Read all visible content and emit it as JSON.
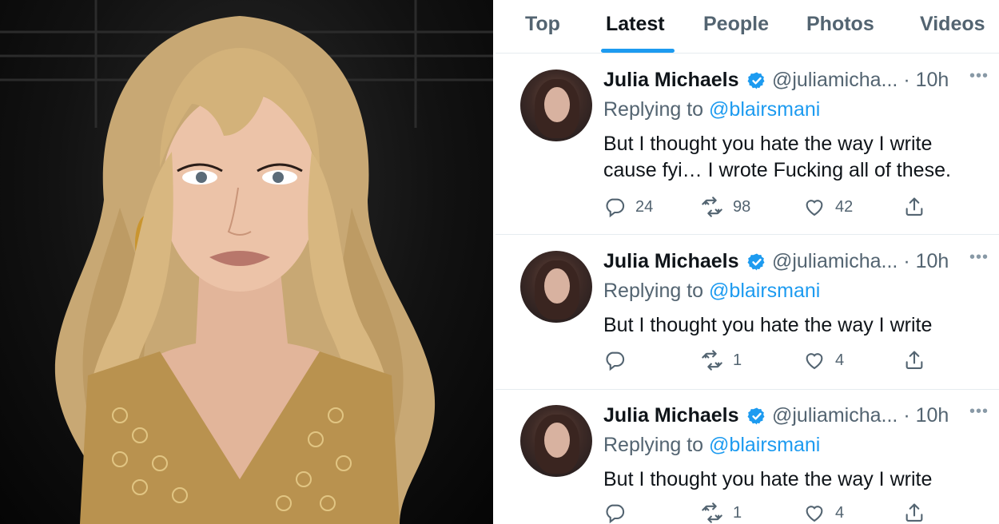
{
  "tabs": [
    {
      "label": "Top"
    },
    {
      "label": "Latest"
    },
    {
      "label": "People"
    },
    {
      "label": "Photos"
    },
    {
      "label": "Videos"
    }
  ],
  "active_tab": "Latest",
  "accent_color": "#1d9bf0",
  "tweets": [
    {
      "name": "Julia Michaels",
      "handle": "@juliamicha... · 10h",
      "replying_prefix": "Replying to ",
      "replying_to": "@blairsmani",
      "text": "But I thought you hate the way I write cause fyi… I wrote Fucking all of these.",
      "replies": "24",
      "retweets": "98",
      "likes": "42"
    },
    {
      "name": "Julia Michaels",
      "handle": "@juliamicha... · 10h",
      "replying_prefix": "Replying to ",
      "replying_to": "@blairsmani",
      "text": "But I thought you hate the way I write",
      "replies": "",
      "retweets": "1",
      "likes": "4"
    },
    {
      "name": "Julia Michaels",
      "handle": "@juliamicha... · 10h",
      "replying_prefix": "Replying to ",
      "replying_to": "@blairsmani",
      "text": "But I thought you hate the way I write",
      "replies": "",
      "retweets": "1",
      "likes": "4"
    }
  ],
  "icons": [
    "reply-icon",
    "retweet-icon",
    "like-icon",
    "share-icon",
    "verified-badge-icon",
    "more-icon"
  ]
}
